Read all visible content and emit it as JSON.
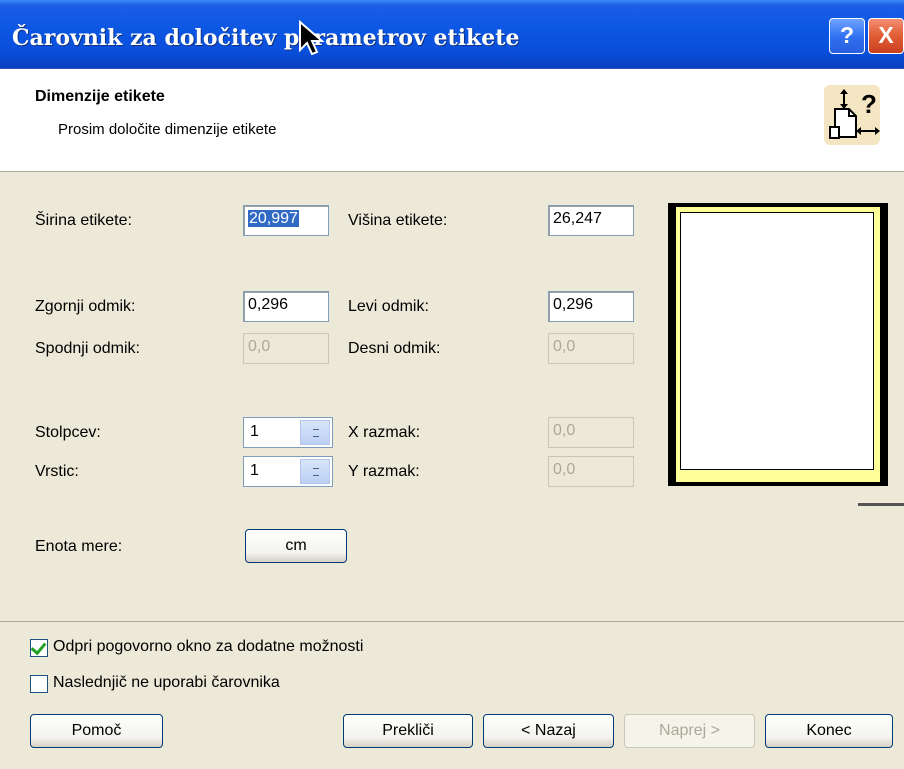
{
  "window": {
    "title": "Čarovnik za določitev parametrov etikete",
    "help_label": "?",
    "close_label": "X"
  },
  "header": {
    "title": "Dimenzije etikete",
    "subtitle": "Prosim določite dimenzije etikete"
  },
  "fields": {
    "sirina": {
      "label": "Širina etikete:",
      "value": "20,997"
    },
    "visina": {
      "label": "Višina etikete:",
      "value": "26,247"
    },
    "zgornji": {
      "label": "Zgornji odmik:",
      "value": "0,296"
    },
    "levi": {
      "label": "Levi odmik:",
      "value": "0,296"
    },
    "spodnji": {
      "label": "Spodnji odmik:",
      "value": "0,0"
    },
    "desni": {
      "label": "Desni odmik:",
      "value": "0,0"
    },
    "stolpcev": {
      "label": "Stolpcev:",
      "value": "1"
    },
    "vrstic": {
      "label": "Vrstic:",
      "value": "1"
    },
    "x_razmak": {
      "label": "X razmak:",
      "value": "0,0"
    },
    "y_razmak": {
      "label": "Y razmak:",
      "value": "0,0"
    },
    "enota": {
      "label": "Enota mere:",
      "value": "cm"
    }
  },
  "options": {
    "dialog_checkbox": {
      "label": "Odpri pogovorno okno za dodatne možnosti",
      "checked": true
    },
    "no_wizard_checkbox": {
      "label": "Naslednjič ne uporabi čarovnika",
      "checked": false
    }
  },
  "buttons": {
    "help": "Pomoč",
    "cancel": "Prekliči",
    "back": "< Nazaj",
    "next": "Naprej >",
    "finish": "Konec"
  },
  "colors": {
    "titlebar": "#0b56e3",
    "dialog_bg": "#ece9d8",
    "preview_paper": "#ffff99",
    "checkmark": "#21a121"
  },
  "icons": [
    "help-icon",
    "close-icon",
    "label-dimensions-icon",
    "spin-arrows-icon",
    "checkmark-icon",
    "mouse-cursor-icon"
  ]
}
